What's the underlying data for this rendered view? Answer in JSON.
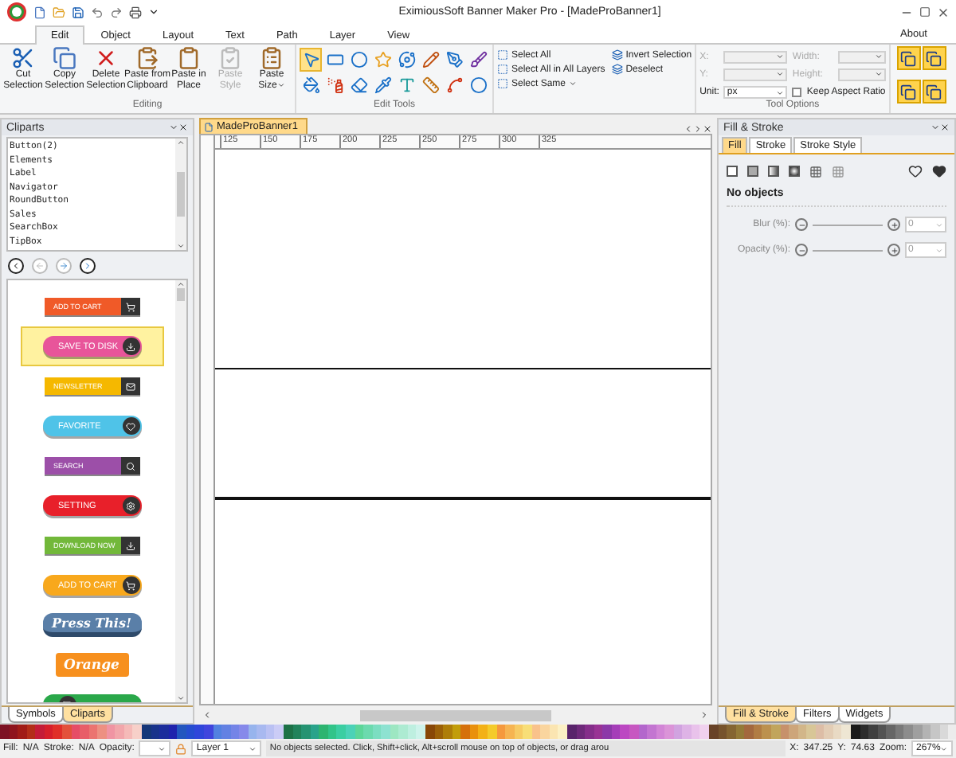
{
  "window": {
    "title": "EximiousSoft Banner Maker Pro - [MadeProBanner1]",
    "about": "About"
  },
  "ribbon_tabs": [
    {
      "label": "Edit",
      "selected": true
    },
    {
      "label": "Object",
      "selected": false
    },
    {
      "label": "Layout",
      "selected": false
    },
    {
      "label": "Text",
      "selected": false
    },
    {
      "label": "Path",
      "selected": false
    },
    {
      "label": "Layer",
      "selected": false
    },
    {
      "label": "View",
      "selected": false
    }
  ],
  "editing": {
    "label": "Editing",
    "buttons": [
      {
        "kind": "cut",
        "lines": [
          "Cut",
          "Selection"
        ],
        "disabled": false,
        "dropdown": false
      },
      {
        "kind": "copy",
        "lines": [
          "Copy",
          "Selection"
        ],
        "disabled": false,
        "dropdown": false
      },
      {
        "kind": "delete",
        "lines": [
          "Delete",
          "Selection"
        ],
        "disabled": false,
        "dropdown": false
      },
      {
        "kind": "paste",
        "lines": [
          "Paste from",
          "Clipboard"
        ],
        "disabled": false,
        "dropdown": false
      },
      {
        "kind": "paste_place",
        "lines": [
          "Paste in",
          "Place"
        ],
        "disabled": false,
        "dropdown": false
      },
      {
        "kind": "paste_style",
        "lines": [
          "Paste",
          "Style"
        ],
        "disabled": true,
        "dropdown": false
      },
      {
        "kind": "paste_size",
        "lines": [
          "Paste",
          "Size"
        ],
        "disabled": false,
        "dropdown": true
      }
    ]
  },
  "edit_tools": {
    "label": "Edit Tools",
    "tools": [
      {
        "kind": "pointer",
        "selected": true
      },
      {
        "kind": "rect",
        "selected": false
      },
      {
        "kind": "ellipse",
        "selected": false
      },
      {
        "kind": "star",
        "selected": false
      },
      {
        "kind": "spiral",
        "selected": false
      },
      {
        "kind": "pencil",
        "selected": false
      },
      {
        "kind": "pen",
        "selected": false
      },
      {
        "kind": "brush",
        "selected": false
      },
      {
        "kind": "bucket",
        "selected": false
      },
      {
        "kind": "spray",
        "selected": false
      },
      {
        "kind": "eraser",
        "selected": false
      },
      {
        "kind": "pipette",
        "selected": false
      },
      {
        "kind": "text",
        "selected": false
      },
      {
        "kind": "ruler",
        "selected": false
      },
      {
        "kind": "connector",
        "selected": false
      },
      {
        "kind": "ellipse_outline",
        "selected": false
      }
    ]
  },
  "select_commands": [
    {
      "label": "Select All",
      "dropdown": false
    },
    {
      "label": "Select All in All Layers",
      "dropdown": false
    },
    {
      "label": "Select Same",
      "dropdown": true
    },
    {
      "label": "Invert Selection",
      "dropdown": false
    },
    {
      "label": "Deselect",
      "dropdown": false
    }
  ],
  "tool_options": {
    "label": "Tool Options",
    "x_label": "X:",
    "y_label": "Y:",
    "unit_label": "Unit:",
    "unit_value": "px",
    "width_label": "Width:",
    "height_label": "Height:",
    "keep_aspect": {
      "label": "Keep Aspect Ratio",
      "checked": false
    }
  },
  "cliparts_panel": {
    "title": "Cliparts",
    "categories": [
      "Button(2)",
      "Elements",
      "Label",
      "Navigator",
      "RoundButton",
      "Sales",
      "SearchBox",
      "TipBox"
    ],
    "items": [
      {
        "kind": "flat",
        "label": "ADD TO CART",
        "color": "#f05a28",
        "selected": false
      },
      {
        "kind": "pill",
        "label": "SAVE TO DISK",
        "color": "#e8559a",
        "selected": true
      },
      {
        "kind": "flat",
        "label": "NEWSLETTER",
        "color": "#f5b800",
        "selected": false
      },
      {
        "kind": "pill",
        "label": "FAVORITE",
        "color": "#4fc3e8",
        "selected": false
      },
      {
        "kind": "flat",
        "label": "SEARCH",
        "color": "#9c4fa8",
        "selected": false
      },
      {
        "kind": "pill",
        "label": "SETTING",
        "color": "#e8202a",
        "selected": false
      },
      {
        "kind": "flat",
        "label": "DOWNLOAD NOW",
        "color": "#72b83a",
        "selected": false
      },
      {
        "kind": "pill",
        "label": "ADD TO CART",
        "color": "#f8a81c",
        "selected": false
      },
      {
        "kind": "script",
        "label": "Press This!",
        "color": "#5a7fa8",
        "selected": false
      },
      {
        "kind": "tag",
        "label": "Orange",
        "color": "#f7901e",
        "selected": false
      },
      {
        "kind": "pill",
        "color": "#2aa84a",
        "selected": false
      }
    ],
    "bottom_tabs": [
      {
        "label": "Symbols",
        "selected": false
      },
      {
        "label": "Cliparts",
        "selected": true
      }
    ]
  },
  "document": {
    "tab": "MadeProBanner1",
    "ruler": [
      "125",
      "150",
      "175",
      "200",
      "225",
      "250",
      "275",
      "300",
      "325"
    ]
  },
  "fill_stroke": {
    "title": "Fill & Stroke",
    "tabs": [
      {
        "label": "Fill",
        "selected": true
      },
      {
        "label": "Stroke",
        "selected": false
      },
      {
        "label": "Stroke Style",
        "selected": false
      }
    ],
    "message": "No objects",
    "rows": [
      {
        "label": "Blur (%):",
        "value": "0"
      },
      {
        "label": "Opacity (%):",
        "value": "0"
      }
    ],
    "bottom_tabs": [
      {
        "label": "Fill & Stroke",
        "selected": true
      },
      {
        "label": "Filters",
        "selected": false
      },
      {
        "label": "Widgets",
        "selected": false
      }
    ]
  },
  "status_bar": {
    "fill_label": "Fill:",
    "fill_value": "N/A",
    "stroke_label": "Stroke:",
    "stroke_value": "N/A",
    "opacity_label": "Opacity:",
    "layer": "Layer 1",
    "message": "No objects selected. Click, Shift+click, Alt+scroll mouse on top of objects, or drag arou",
    "x_label": "X:",
    "x_value": "347.25",
    "y_label": "Y:",
    "y_value": "74.63",
    "zoom_label": "Zoom:",
    "zoom_value": "267%"
  }
}
